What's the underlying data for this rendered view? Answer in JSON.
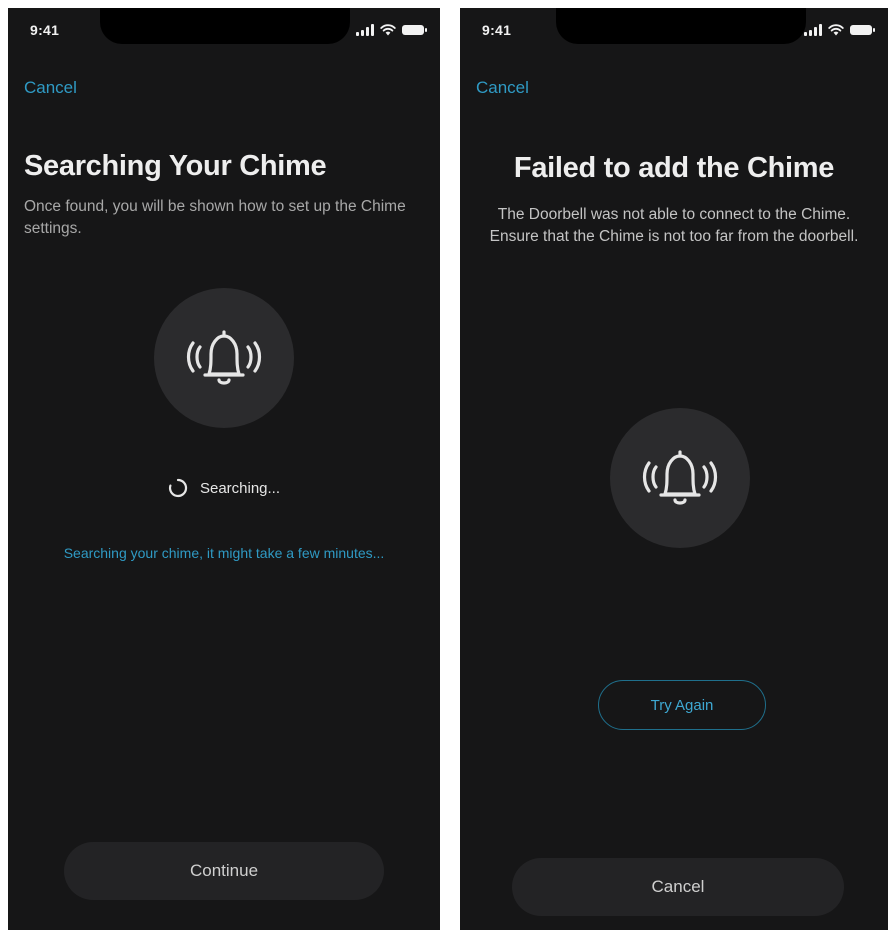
{
  "left": {
    "status_time": "9:41",
    "cancel_label": "Cancel",
    "title": "Searching Your Chime",
    "description": "Once found, you will be shown how to set up the Chime settings.",
    "searching_label": "Searching...",
    "hint": "Searching your chime, it might take a few minutes...",
    "continue_label": "Continue"
  },
  "right": {
    "status_time": "9:41",
    "cancel_link_label": "Cancel",
    "title": "Failed to add the Chime",
    "description": "The Doorbell was not able to connect to the Chime. Ensure that the Chime is not too far from the doorbell.",
    "try_again_label": "Try Again",
    "cancel_button_label": "Cancel"
  },
  "icons": {
    "bell": "bell-ringing-icon",
    "spinner": "loading-spinner-icon",
    "signal": "cellular-signal-icon",
    "wifi": "wifi-icon",
    "battery": "battery-icon"
  },
  "colors": {
    "background": "#161617",
    "accent": "#2f9ac4",
    "circle": "#2b2b2d",
    "button": "#232325"
  }
}
